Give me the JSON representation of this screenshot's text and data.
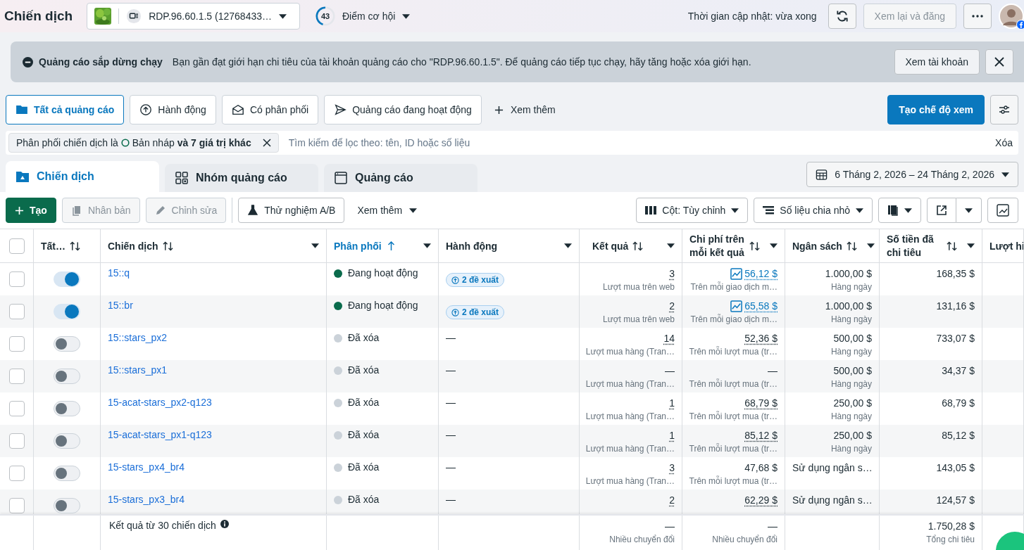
{
  "header": {
    "title": "Chiến dịch",
    "account": "RDP.96.60.1.5 (12768433…",
    "score": "43",
    "score_label": "Điểm cơ hội",
    "updated": "Thời gian cập nhật: vừa xong",
    "review_button": {
      "label": "Xem lại và đăng",
      "disabled": true
    }
  },
  "banner": {
    "title": "Quảng cáo sắp dừng chạy",
    "message": "Bạn gần đạt giới hạn chi tiêu của tài khoản quảng cáo cho \"RDP.96.60.1.5\". Để quảng cáo tiếp tục chạy, hãy tăng hoặc xóa giới hạn.",
    "button": "Xem tài khoản"
  },
  "quick_filters": [
    {
      "label": "Tất cả quảng cáo",
      "selected": true
    },
    {
      "label": "Hành động",
      "selected": false
    },
    {
      "label": "Có phân phối",
      "selected": false
    },
    {
      "label": "Quảng cáo đang hoạt động",
      "selected": false
    }
  ],
  "more_filters": "Xem thêm",
  "create_view": "Tạo chế độ xem",
  "filter": {
    "prefix": "Phân phối chiến dịch là",
    "value": "Bản nháp **và 7 giá trị khác**",
    "placeholder": "Tìm kiếm để lọc theo: tên, ID hoặc số liệu",
    "clear": "Xóa"
  },
  "tabs": [
    {
      "label": "Chiến dịch",
      "selected": true
    },
    {
      "label": "Nhóm quảng cáo",
      "selected": false
    },
    {
      "label": "Quảng cáo",
      "selected": false
    }
  ],
  "date_range": "6 Tháng 2, 2026 – 24 Tháng 2, 2026",
  "toolbar": {
    "create": "Tạo",
    "duplicate": {
      "label": "Nhân bản",
      "disabled": true
    },
    "edit": {
      "label": "Chỉnh sửa",
      "disabled": true
    },
    "ab_test": "Thử nghiệm A/B",
    "more": "Xem thêm",
    "columns": "Cột: Tùy chỉnh",
    "breakdown": "Số liệu chia nhỏ"
  },
  "columns": [
    {
      "label": "Tất…",
      "sortable": true,
      "sorted": false,
      "menu": false
    },
    {
      "label": "Chiến dịch",
      "sortable": true,
      "sorted": false,
      "menu": true
    },
    {
      "label": "Phân phối",
      "sortable": false,
      "sorted": true,
      "menu": true
    },
    {
      "label": "Hành động",
      "sortable": false,
      "sorted": false,
      "menu": true
    },
    {
      "label": "Kết quả",
      "sortable": true,
      "sorted": false,
      "menu": true
    },
    {
      "label": "Chi phí trên mỗi kết quả",
      "sortable": true,
      "sorted": false,
      "menu": true
    },
    {
      "label": "Ngân sách",
      "sortable": true,
      "sorted": false,
      "menu": true
    },
    {
      "label": "Số tiền đã chi tiêu",
      "sortable": true,
      "sorted": false,
      "menu": true
    },
    {
      "label": "Lượt hi",
      "sorted": false
    }
  ],
  "select_all": {
    "checked": false
  },
  "rows": [
    {
      "checked": false,
      "on": true,
      "name": "15::q",
      "delivery": {
        "label": "Đang hoạt động",
        "color": "#0a6b4c"
      },
      "actions": {
        "kind": "badge",
        "text": "2 đề xuất"
      },
      "result": {
        "value": "3",
        "dotted": true,
        "sub": "Lượt mua trên web"
      },
      "cost": {
        "value": "56,12 $",
        "trend": true,
        "dotted": true,
        "sub": "Trên mỗi giao dịch m…"
      },
      "budget": {
        "kind": "amount",
        "value": "1.000,00 $",
        "sub": "Hàng ngày"
      },
      "spent": "168,35 $"
    },
    {
      "checked": false,
      "on": true,
      "name": "15::br",
      "delivery": {
        "label": "Đang hoạt động",
        "color": "#0a6b4c"
      },
      "actions": {
        "kind": "badge",
        "text": "2 đề xuất"
      },
      "result": {
        "value": "2",
        "dotted": true,
        "sub": "Lượt mua trên web"
      },
      "cost": {
        "value": "65,58 $",
        "trend": true,
        "dotted": true,
        "sub": "Trên mỗi giao dịch m…"
      },
      "budget": {
        "kind": "amount",
        "value": "1.000,00 $",
        "sub": "Hàng ngày"
      },
      "spent": "131,16 $"
    },
    {
      "checked": false,
      "on": false,
      "name": "15::stars_px2",
      "delivery": {
        "label": "Đã xóa",
        "color": "#cbd2d9"
      },
      "actions": {
        "kind": "none",
        "text": "—"
      },
      "result": {
        "value": "14",
        "dotted": true,
        "sub": "Lượt mua hàng (Tran…"
      },
      "cost": {
        "value": "52,36 $",
        "trend": false,
        "dotted": true,
        "sub": "Trên mỗi lượt mua (tr…"
      },
      "budget": {
        "kind": "amount",
        "value": "500,00 $",
        "sub": "Hàng ngày"
      },
      "spent": "733,07 $"
    },
    {
      "checked": false,
      "on": false,
      "name": "15::stars_px1",
      "delivery": {
        "label": "Đã xóa",
        "color": "#cbd2d9"
      },
      "actions": {
        "kind": "none",
        "text": "—"
      },
      "result": {
        "value": "—",
        "dotted": false,
        "sub": "Lượt mua hàng (Tran…"
      },
      "cost": {
        "value": "—",
        "trend": false,
        "dotted": false,
        "sub": "Trên mỗi lượt mua (tr…"
      },
      "budget": {
        "kind": "amount",
        "value": "500,00 $",
        "sub": "Hàng ngày"
      },
      "spent": "34,37 $"
    },
    {
      "checked": false,
      "on": false,
      "name": "15-acat-stars_px2-q123",
      "delivery": {
        "label": "Đã xóa",
        "color": "#cbd2d9"
      },
      "actions": {
        "kind": "none",
        "text": "—"
      },
      "result": {
        "value": "1",
        "dotted": true,
        "sub": "Lượt mua hàng (Tran…"
      },
      "cost": {
        "value": "68,79 $",
        "trend": false,
        "dotted": true,
        "sub": "Trên mỗi lượt mua (tr…"
      },
      "budget": {
        "kind": "amount",
        "value": "250,00 $",
        "sub": "Hàng ngày"
      },
      "spent": "68,79 $"
    },
    {
      "checked": false,
      "on": false,
      "name": "15-acat-stars_px1-q123",
      "delivery": {
        "label": "Đã xóa",
        "color": "#cbd2d9"
      },
      "actions": {
        "kind": "none",
        "text": "—"
      },
      "result": {
        "value": "1",
        "dotted": true,
        "sub": "Lượt mua hàng (Tran…"
      },
      "cost": {
        "value": "85,12 $",
        "trend": false,
        "dotted": true,
        "sub": "Trên mỗi lượt mua (tr…"
      },
      "budget": {
        "kind": "amount",
        "value": "250,00 $",
        "sub": "Hàng ngày"
      },
      "spent": "85,12 $"
    },
    {
      "checked": false,
      "on": false,
      "name": "15-stars_px4_br4",
      "delivery": {
        "label": "Đã xóa",
        "color": "#cbd2d9"
      },
      "actions": {
        "kind": "none",
        "text": "—"
      },
      "result": {
        "value": "3",
        "dotted": true,
        "sub": "Lượt mua hàng (Tran…"
      },
      "cost": {
        "value": "47,68 $",
        "trend": false,
        "dotted": false,
        "sub": "Trên mỗi lượt mua (tr…"
      },
      "budget": {
        "kind": "text",
        "value": "Sử dụng ngân s…"
      },
      "spent": "143,05 $"
    },
    {
      "checked": false,
      "on": false,
      "name": "15-stars_px3_br4",
      "delivery": {
        "label": "Đã xóa",
        "color": "#cbd2d9"
      },
      "actions": {
        "kind": "none",
        "text": "—"
      },
      "result": {
        "value": "2",
        "dotted": true
      },
      "cost": {
        "value": "62,29 $",
        "trend": false,
        "dotted": true
      },
      "budget": {
        "kind": "text",
        "value": "Sử dụng ngân s…"
      },
      "spent": "124,57 $"
    }
  ],
  "footer": {
    "label": "Kết quả từ 30 chiến dịch",
    "result": {
      "value": "—",
      "sub": "Nhiều chuyển đổi"
    },
    "cost": {
      "value": "—",
      "sub": "Nhiều chuyển đổi"
    },
    "spent": {
      "value": "1.750,28 $",
      "sub": "Tổng chi tiêu"
    }
  }
}
